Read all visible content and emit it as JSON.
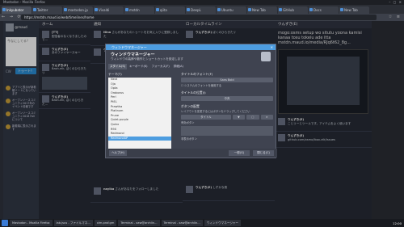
{
  "browser": {
    "window_title": "Mastodon - Mozilla Firefox",
    "window_controls": "– ▢ ✕",
    "tabs": [
      {
        "label": "Inkyubator",
        "active": true
      },
      {
        "label": "Twitter"
      },
      {
        "label": "mastodon.jp"
      },
      {
        "label": "Vivaldi"
      },
      {
        "label": "mstdn"
      },
      {
        "label": "qiita"
      },
      {
        "label": "DeepL"
      },
      {
        "label": "Ubuntu"
      },
      {
        "label": "New Tab"
      },
      {
        "label": "GitHub"
      },
      {
        "label": "Docs"
      },
      {
        "label": "New Tab"
      }
    ],
    "url": "https://mstdn.maud.io/web/timelines/home",
    "nav_icons": "← → ⟳ ⌂",
    "tool_icons": "☆ ≡"
  },
  "compose": {
    "user": "@maud",
    "placeholder": "今なにしてる？",
    "cw_label": "CW",
    "toot_button": "トゥート！",
    "notes": [
      "アプリと表示が新着順ソートになっています",
      "オープンソースコミュニティ2017年のイベント情報です",
      "オープンソースコミュニティ2018 Fall について",
      "新着順に表示されます"
    ]
  },
  "columns": {
    "home": {
      "header": "ホーム",
      "toots": [
        {
          "name": "[TT]",
          "text": "配信者のなくなりましたので…"
        },
        {
          "name": "ウんずき(E)",
          "text": "あのファイヤースキー"
        },
        {
          "name": "ウんずき(E)",
          "text": "Bash-elk, ぼくのひらきたリ"
        },
        {
          "name": "ウんずき(E)",
          "text": "Bash-elk, ぼくのひらきた…"
        }
      ]
    },
    "notifications": {
      "header": "通知",
      "toots": [
        {
          "name": "Nina",
          "text": "さんがあなたのトゥートをお気に入りに登録しました"
        },
        {
          "name": "ウんずき(E)",
          "text": "みなさんおはよう"
        },
        {
          "name": "nayika",
          "text": "さんがあなたをフォローしました"
        }
      ]
    },
    "local": {
      "header": "ローカルタイムライン",
      "toots": [
        {
          "name": "ウんずき(E)",
          "text": "ぼくのひらきたリ"
        },
        {
          "name": "ウんずき(E)",
          "text": "しずかな夜"
        }
      ]
    },
    "media": {
      "header": "ウんずき(E)",
      "big_text": "mogo:osms setup wo situtu yoona kamisi kanaa tosu tokeiu ade itta mstdn.maud.io/media/RJq6t62_8g...",
      "toots": [
        {
          "name": "ウんずき(E)",
          "text": "ことリーとツールです。アイテムをよく使います"
        },
        {
          "name": "ウんずき(E)",
          "text": "github.com/osmo/lbox-elk/issues"
        }
      ]
    }
  },
  "dialog": {
    "window_title": "ウィンドウマネージャー",
    "close_icon": "✕",
    "heading": "ウィンドウマネージャー",
    "subheading": "ウィンドウの装飾や動作とショートカットを設定します",
    "tabs": [
      "スタイル(S)",
      "キーボード(K)",
      "フォーカス(F)",
      "詳細(A)"
    ],
    "theme_label": "テーマ(T)",
    "themes": [
      "Next",
      "Oja",
      "Opta",
      "Oroborus",
      "Perl",
      "PtEL",
      "Prawtha",
      "Platinum",
      "Prune",
      "Quiet-purple",
      "Quinx",
      "R9X",
      "Redmond",
      "RedmondXP"
    ],
    "selected_theme": "RedmondXP",
    "title_font_label": "タイトルのフォント(F)",
    "title_font_value": "Sans Bold",
    "title_font_checkbox": "システムのフォントを使用する",
    "alignment_label": "タイトルの位置(I)",
    "alignment_value": "中央",
    "buttons_label": "ボタンの配置",
    "buttons_desc": "レイアウトを変更するにはボタンをドラッグしてください",
    "layout_buttons": [
      "タイトル",
      "▼",
      "□",
      "✕"
    ],
    "active_label": "有効ボタン",
    "hidden_label": "非表示ボタン",
    "help_button": "ヘルプ(H)",
    "ok_button": "一般(G)",
    "close_button": "閉じる(C)"
  },
  "taskbar": {
    "items": [
      "Mastodon - Mozilla Firefox",
      "lab.jsus - ファイルマネ...",
      "xlm.prof.gm",
      "Terminal - xaw@archlin...",
      "Terminal - xaw@archlin...",
      "ウィンドウマネージャー"
    ],
    "clock": "12:00"
  }
}
